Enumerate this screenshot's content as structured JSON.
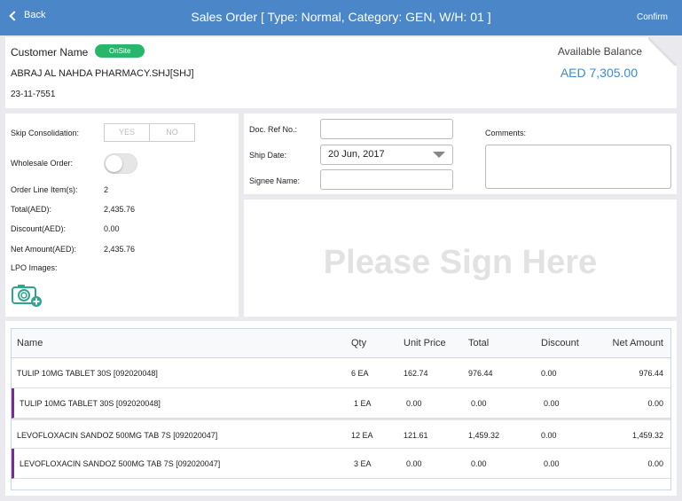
{
  "nav": {
    "back_label": "Back",
    "title": "Sales Order [ Type: Normal, Category: GEN, W/H: 01 ]",
    "confirm_label": "Confirm"
  },
  "customer": {
    "label": "Customer Name",
    "badge": "OnSite",
    "name": "ABRAJ AL NAHDA PHARMACY.SHJ[SHJ]",
    "code": "23-11-7551",
    "balance_label": "Available Balance",
    "balance_value": "AED 7,305.00"
  },
  "order": {
    "skip_label": "Skip Consolidation:",
    "yes": "YES",
    "no": "NO",
    "wholesale_label": "Wholesale Order:",
    "line_items_label": "Order Line Item(s):",
    "line_items_value": "2",
    "total_label": "Total(AED):",
    "total_value": "2,435.76",
    "discount_label": "Discount(AED):",
    "discount_value": "0.00",
    "net_label": "Net Amount(AED):",
    "net_value": "2,435.76",
    "lpo_label": "LPO Images:"
  },
  "doc": {
    "ref_label": "Doc. Ref No.:",
    "ship_label": "Ship Date:",
    "ship_value": "20 Jun, 2017",
    "signee_label": "Signee Name:",
    "comments_label": "Comments:"
  },
  "signature": {
    "placeholder": "Please Sign Here"
  },
  "table": {
    "headers": [
      "Name",
      "Qty",
      "Unit Price",
      "Total",
      "Discount",
      "Net Amount"
    ],
    "rows": [
      [
        "TULIP 10MG TABLET 30S [092020048]",
        "6 EA",
        "162.74",
        "976.44",
        "0.00",
        "976.44"
      ],
      [
        "TULIP 10MG TABLET 30S [092020048]",
        "1 EA",
        "0.00",
        "0.00",
        "0.00",
        "0.00"
      ],
      [
        "LEVOFLOXACIN SANDOZ 500MG TAB 7S [092020047]",
        "12 EA",
        "121.61",
        "1,459.32",
        "0.00",
        "1,459.32"
      ],
      [
        "LEVOFLOXACIN SANDOZ 500MG TAB 7S [092020047]",
        "3 EA",
        "0.00",
        "0.00",
        "0.00",
        "0.00"
      ]
    ]
  },
  "colors": {
    "nav": "#4a86c8",
    "badge": "#27b66a",
    "balance": "#3d8bd1",
    "sub_row_marker": "#7b2c8f"
  },
  "icons": {
    "back": "chevron-left-icon",
    "camera": "camera-add-icon",
    "dropdown": "caret-down-icon"
  }
}
